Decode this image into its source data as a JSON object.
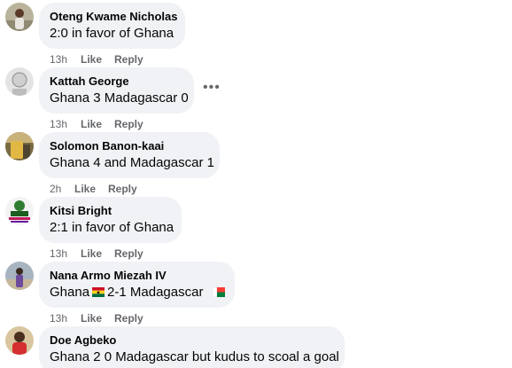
{
  "comments": [
    {
      "author": "Oteng Kwame Nicholas",
      "text": "2:0 in favor of Ghana",
      "time": "13h",
      "like": "Like",
      "reply": "Reply"
    },
    {
      "author": "Kattah George",
      "text": "Ghana 3 Madagascar 0",
      "time": "13h",
      "like": "Like",
      "reply": "Reply",
      "more": "•••"
    },
    {
      "author": "Solomon Banon-kaai",
      "text": "Ghana 4 and Madagascar 1",
      "time": "2h",
      "like": "Like",
      "reply": "Reply"
    },
    {
      "author": "Kitsi Bright",
      "text": "2:1 in favor of Ghana",
      "time": "13h",
      "like": "Like",
      "reply": "Reply"
    },
    {
      "author": "Nana Armo Miezah IV",
      "text_part1": "Ghana",
      "text_part2": "2-1 Madagascar",
      "time": "13h",
      "like": "Like",
      "reply": "Reply"
    },
    {
      "author": "Doe Agbeko",
      "text": "Ghana 2 0 Madagascar but kudus to scoal a goal"
    }
  ],
  "colors": {
    "bubble": "#f0f2f5",
    "meta": "#65676b",
    "text": "#050505"
  }
}
